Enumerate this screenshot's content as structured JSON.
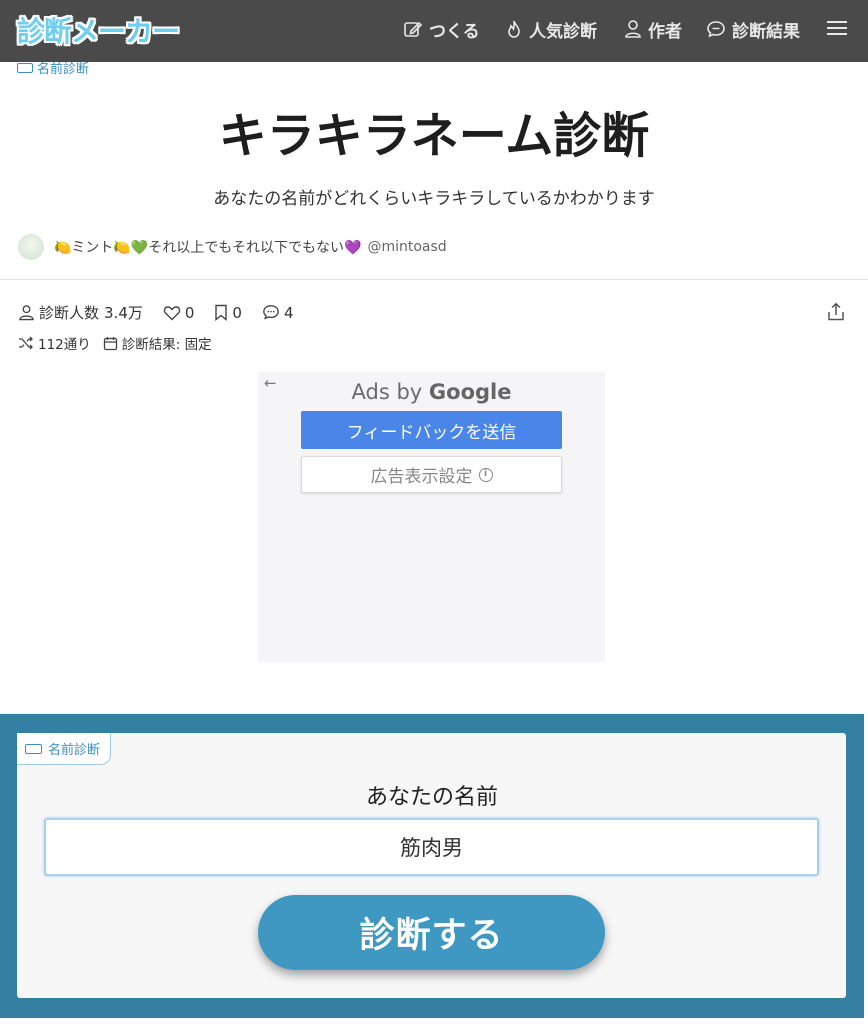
{
  "header": {
    "logo": "診断メーカー",
    "nav": {
      "make": "つくる",
      "popular": "人気診断",
      "author": "作者",
      "results": "診断結果"
    }
  },
  "category": "名前診断",
  "title": "キラキラネーム診断",
  "description": "あなたの名前がどれくらいキラキラしているかわかります",
  "author": {
    "name": "🍋ミント🍋💚それ以上でもそれ以下でもない💜",
    "handle": "@mintoasd"
  },
  "stats": {
    "participants_label": "診断人数",
    "participants": "3.4万",
    "likes": "0",
    "bookmarks": "0",
    "comments": "4",
    "patterns": "112通り",
    "result_type": "診断結果: 固定"
  },
  "ad": {
    "back": "←",
    "ads_by": "Ads by",
    "brand": "Google",
    "feedback_button": "フィードバックを送信",
    "settings_button": "広告表示設定"
  },
  "form": {
    "tag": "名前診断",
    "name_label": "あなたの名前",
    "name_value": "筋肉男",
    "submit_label": "診断する"
  },
  "colors": {
    "header_bg": "#4a4a4a",
    "logo": "#6fcdf0",
    "accent": "#3f98c2",
    "form_frame": "#347fa2",
    "ad_button": "#4a86e8"
  }
}
